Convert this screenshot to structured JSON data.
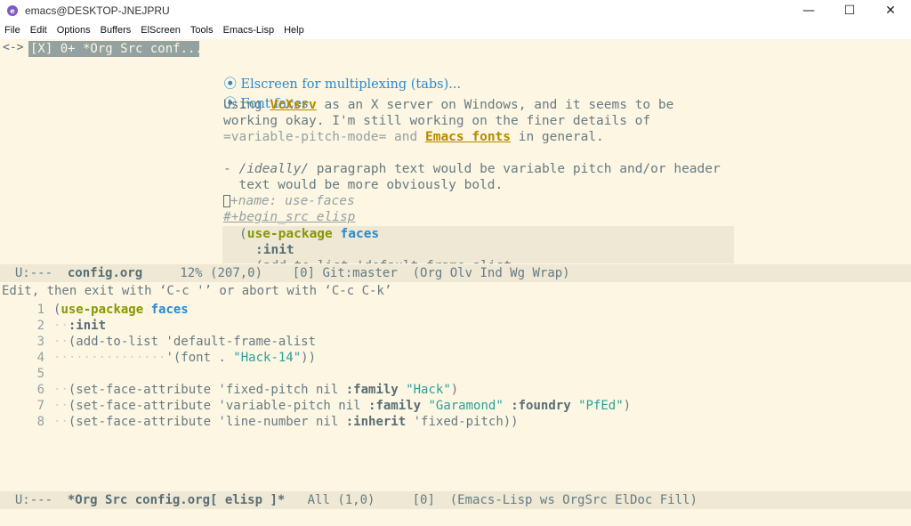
{
  "window": {
    "title": "emacs@DESKTOP-JNEJPRU",
    "min": "—",
    "max": "☐",
    "close": "✕"
  },
  "menu": [
    "File",
    "Edit",
    "Options",
    "Buffers",
    "ElScreen",
    "Tools",
    "Emacs-Lisp",
    "Help"
  ],
  "tabs": {
    "nav": "<->",
    "active": "[X] 0+ *Org Src conf..."
  },
  "org": {
    "h1": "Elscreen for multiplexing (tabs)...",
    "h2": "Font faces",
    "p1a": "Using ",
    "p1link": "VcXsrv",
    "p1b": " as an X server on Windows, and it seems to be",
    "p2": "working okay. I'm still working on the finer details of",
    "p3a": "=variable-pitch-mode= and ",
    "p3link": "Emacs fonts",
    "p3b": " in general.",
    "li1a": "- ",
    "li1b": "/ideally/",
    "li1c": " paragraph text would be variable pitch and/or header",
    "li2": "  text would be more obviously bold.",
    "name": "+name: use-faces",
    "begin": "#+begin_src elisp",
    "s1kw": "use-package",
    "s1fn": "faces",
    "s2": ":init",
    "s3": "(add-to-list 'default-frame-alist"
  },
  "modeline1": {
    "status": "U:---  ",
    "buffer": "config.org",
    "rest": "     12% (207,0)    [0] Git:master  (Org Olv Ind Wg Wrap)"
  },
  "echo": "Edit, then exit with ‘C-c '’ or abort with ‘C-c C-k’",
  "src": {
    "lines": [
      "1",
      "2",
      "3",
      "4",
      "5",
      "6",
      "7",
      "8"
    ],
    "c1kw": "use-package",
    "c1fn": "faces",
    "c2": ":init",
    "c3": "(add-to-list 'default-frame-alist",
    "c4a": "'(font . ",
    "c4s": "\"Hack-14\"",
    "c4b": "))",
    "c6a": "(set-face-attribute 'fixed-pitch nil ",
    "c6k": ":family",
    "c6s": "\"Hack\"",
    "c7a": "(set-face-attribute 'variable-pitch nil ",
    "c7k": ":family",
    "c7s": "\"Garamond\"",
    "c7k2": ":foundry",
    "c7s2": "\"PfEd\"",
    "c8a": "(set-face-attribute 'line-number nil ",
    "c8k": ":inherit",
    "c8b": " 'fixed-pitch))"
  },
  "modeline2": {
    "status": "U:---  ",
    "buffer": "*Org Src config.org[ elisp ]*",
    "rest": "   All (1,0)     [0]  (Emacs-Lisp ws OrgSrc ElDoc Fill)"
  }
}
